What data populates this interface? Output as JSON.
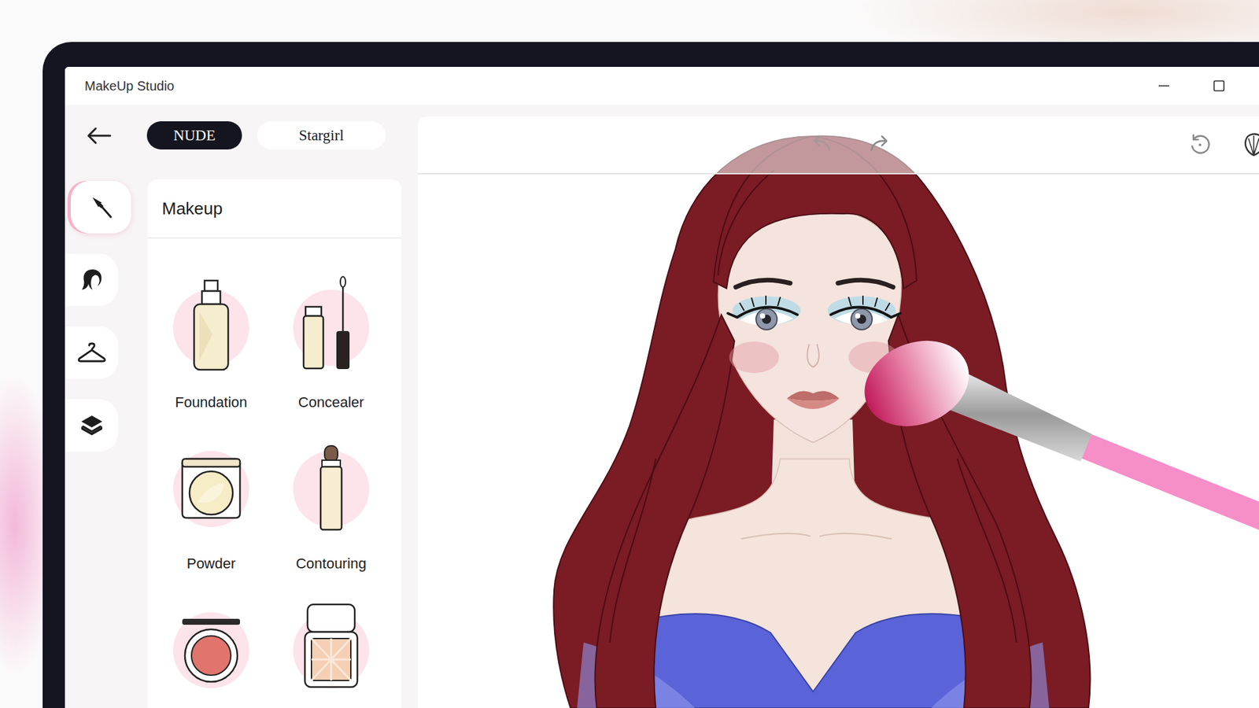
{
  "window": {
    "title": "MakeUp Studio"
  },
  "tabs": [
    {
      "label": "NUDE",
      "selected": true
    },
    {
      "label": "Stargirl",
      "selected": false
    }
  ],
  "rail": [
    {
      "kind": "makeup",
      "selected": true
    },
    {
      "kind": "hair",
      "selected": false
    },
    {
      "kind": "outfit",
      "selected": false
    },
    {
      "kind": "layers",
      "selected": false
    }
  ],
  "panel": {
    "title": "Makeup",
    "products": [
      {
        "kind": "foundation",
        "label": "Foundation"
      },
      {
        "kind": "concealer",
        "label": "Concealer"
      },
      {
        "kind": "powder",
        "label": "Powder"
      },
      {
        "kind": "contouring",
        "label": "Contouring"
      },
      {
        "kind": "blush"
      },
      {
        "kind": "highlighter"
      }
    ]
  }
}
